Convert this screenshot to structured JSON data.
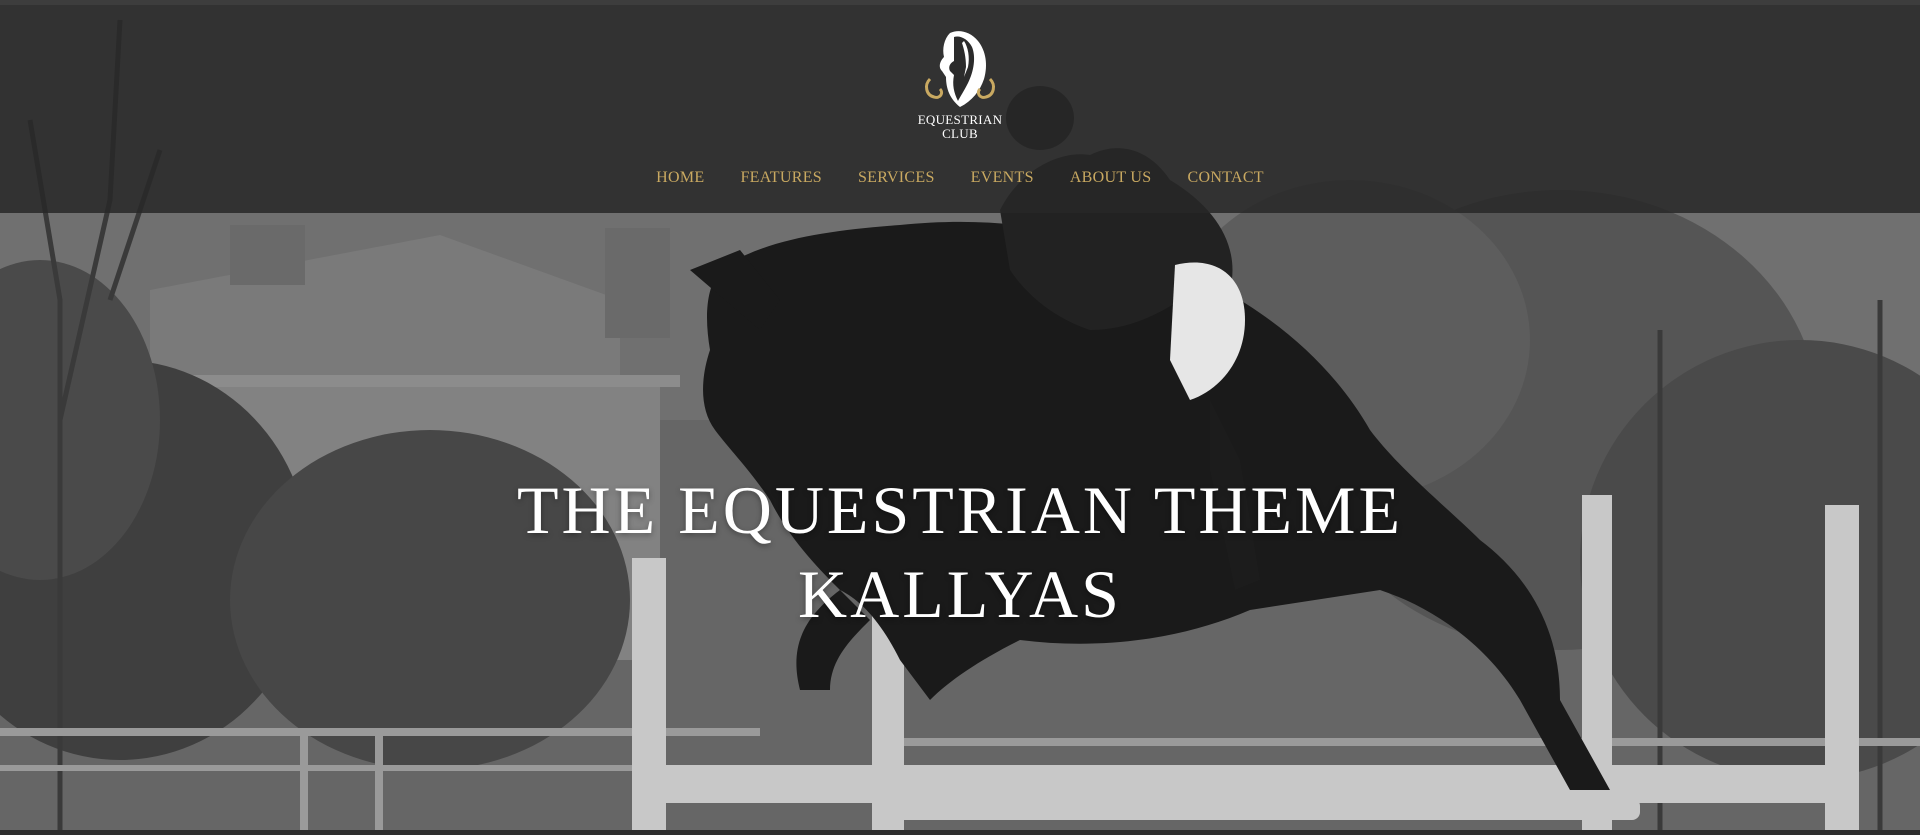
{
  "brand": {
    "logo_icon": "horse-head-crest-icon",
    "line1": "EQUESTRIAN",
    "line2": "CLUB",
    "accent_color": "#c9a961"
  },
  "nav": {
    "items": [
      {
        "label": "HOME"
      },
      {
        "label": "FEATURES"
      },
      {
        "label": "SERVICES"
      },
      {
        "label": "EVENTS"
      },
      {
        "label": "ABOUT US"
      },
      {
        "label": "CONTACT"
      }
    ]
  },
  "hero": {
    "title_line1": "THE EQUESTRIAN THEME",
    "title_line2": "KALLYAS"
  }
}
